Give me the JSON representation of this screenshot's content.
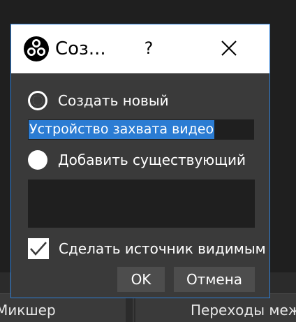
{
  "dialog": {
    "title": "Соз...",
    "help_label": "?",
    "create_new_label": "Создать новый",
    "source_name_value": "Устройство захвата видео",
    "add_existing_label": "Добавить существующий",
    "make_visible_label": "Сделать источник видимым",
    "make_visible_checked": true,
    "create_new_selected": true,
    "ok_label": "OK",
    "cancel_label": "Отмена"
  },
  "background": {
    "dock_left_label": "Микшер",
    "dock_right_label": "Переходы меж"
  },
  "colors": {
    "dialog_bg": "#3a3a3a",
    "input_bg": "#1f1f1f",
    "selection": "#2b7cd3",
    "border_accent": "#2f7fd6",
    "button_bg": "#4d4d4d"
  },
  "icons": [
    "obs-logo-icon",
    "close-icon",
    "checkmark-icon"
  ]
}
